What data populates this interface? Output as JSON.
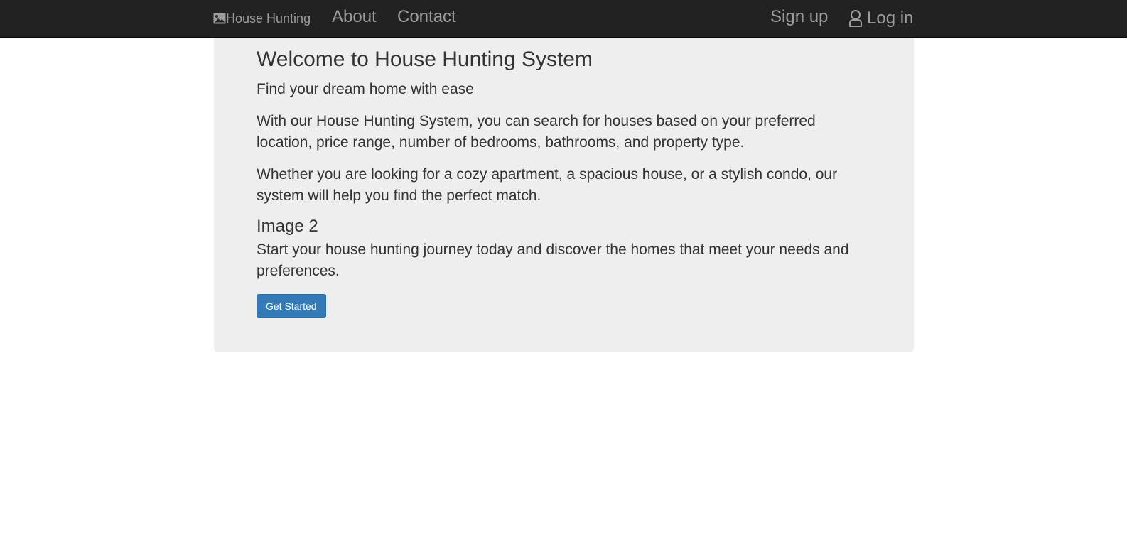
{
  "navbar": {
    "brand_label": "House Hunting",
    "brand_icon": "image-icon",
    "links": {
      "about": "About",
      "contact": "Contact",
      "signup": "Sign up",
      "login": "Log in"
    },
    "login_icon": "user-icon",
    "background_color": "#222222",
    "link_color": "#9d9d9d"
  },
  "hero": {
    "title": "Welcome to House Hunting System",
    "subtitle": "Find your dream home with ease",
    "paragraph_1": "With our House Hunting System, you can search for houses based on your preferred location, price range, number of bedrooms, bathrooms, and property type.",
    "paragraph_2": "Whether you are looking for a cozy apartment, a spacious house, or a stylish condo, our system will help you find the perfect match.",
    "image_alt": "Image 2",
    "paragraph_3": "Start your house hunting journey today and discover the homes that meet your needs and preferences.",
    "cta_label": "Get Started",
    "background_color": "#eeeeee",
    "cta_color": "#337ab7"
  }
}
